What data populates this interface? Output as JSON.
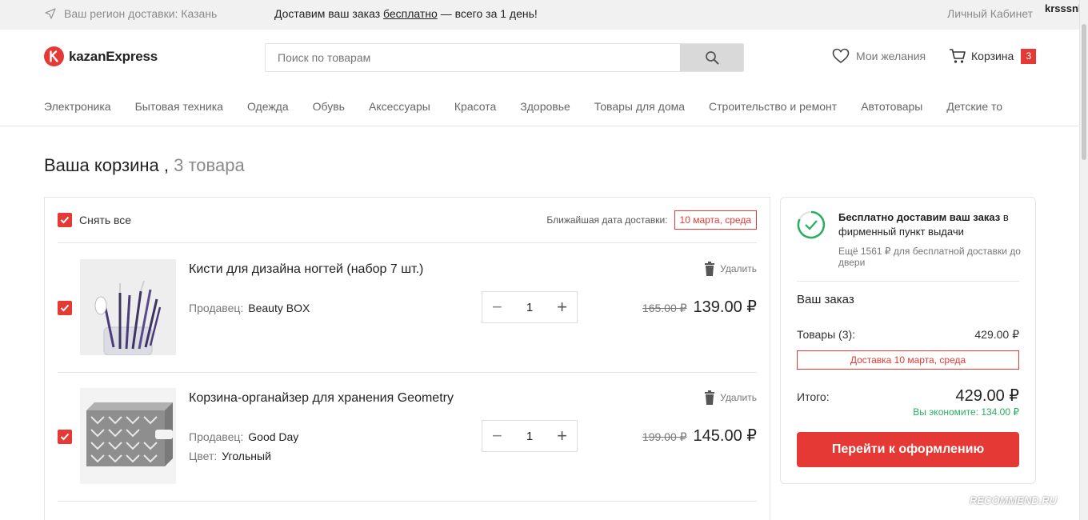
{
  "topbar": {
    "region": "Ваш регион доставки: Казань",
    "promo_prefix": "Доставим ваш заказ",
    "promo_link": "бесплатно",
    "promo_suffix": "— всего за 1 день!",
    "cabinet": "Личный Кабинет",
    "user": "krsssnk"
  },
  "header": {
    "brand": "kazanExpress",
    "search_placeholder": "Поиск по товарам",
    "wishlist": "Мои желания",
    "cart_label": "Корзина",
    "cart_count": "3"
  },
  "categories": [
    "Электроника",
    "Бытовая техника",
    "Одежда",
    "Обувь",
    "Аксессуары",
    "Красота",
    "Здоровье",
    "Товары для дома",
    "Строительство и ремонт",
    "Автотовары",
    "Детские то"
  ],
  "cart": {
    "title": "Ваша корзина ,",
    "count_text": "3 товара",
    "select_all": "Снять все",
    "delivery_label": "Ближайшая дата доставки:",
    "delivery_date": "10 марта, среда",
    "items": [
      {
        "name": "Кисти для дизайна ногтей (набор 7 шт.)",
        "seller_label": "Продавец:",
        "seller": "Beauty BOX",
        "delete": "Удалить",
        "qty": "1",
        "old_price": "165.00 ₽",
        "price": "139.00 ₽"
      },
      {
        "name": "Корзина-органайзер для хранения Geometry",
        "seller_label": "Продавец:",
        "seller": "Good Day",
        "color_label": "Цвет:",
        "color": "Угольный",
        "delete": "Удалить",
        "qty": "1",
        "old_price": "199.00 ₽",
        "price": "145.00 ₽"
      }
    ]
  },
  "summary": {
    "free_bold": "Бесплатно доставим ваш заказ",
    "free_rest": "в фирменный пункт выдачи",
    "free_sub": "Ещё 1561 ₽ для бесплатной доставки до двери",
    "order_title": "Ваш заказ",
    "goods_label": "Товары (3):",
    "goods_value": "429.00 ₽",
    "delivery": "Доставка 10 марта, среда",
    "total_label": "Итого:",
    "total_value": "429.00 ₽",
    "savings": "Вы экономите: 134.00 ₽",
    "checkout": "Перейти к оформлению"
  },
  "watermark": "RECOMMEND.RU",
  "colors": {
    "accent": "#e53935",
    "success": "#27ae60",
    "muted": "#8a8a8a"
  }
}
